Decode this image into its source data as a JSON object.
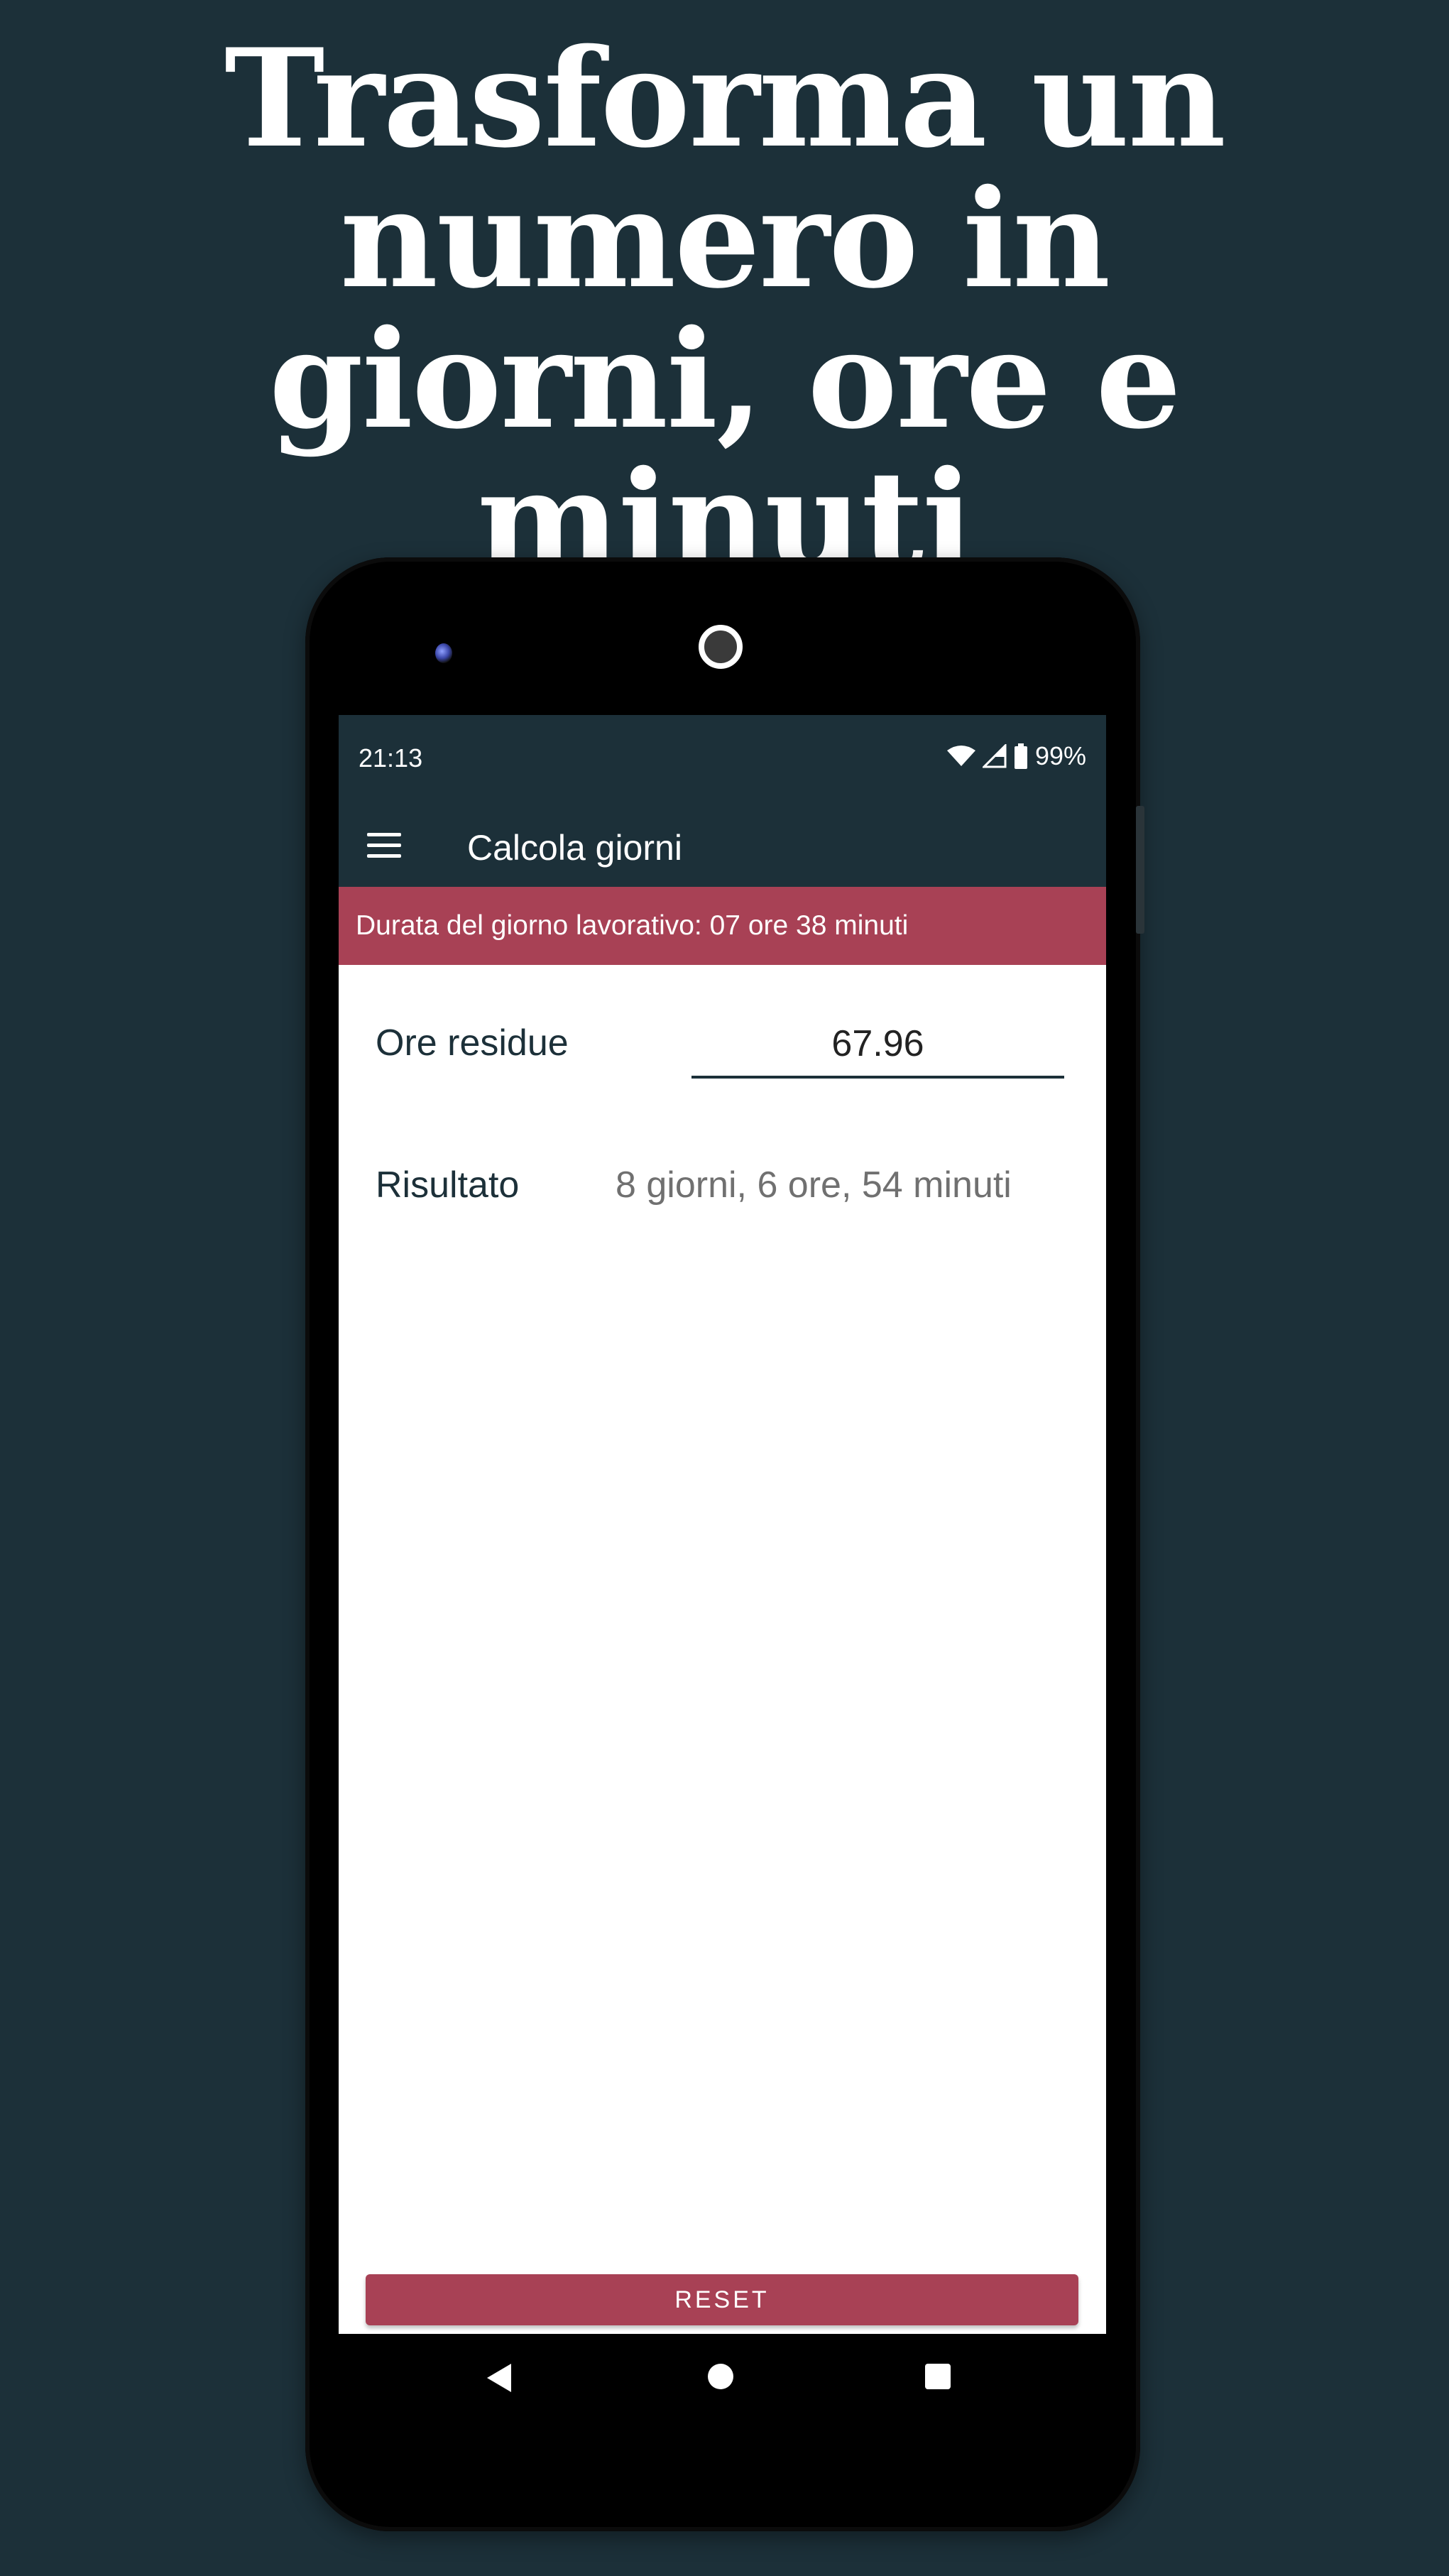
{
  "promo": {
    "headline_lines": [
      "Trasforma un",
      "numero in",
      "giorni, ore e minuti"
    ]
  },
  "status_bar": {
    "time": "21:13",
    "battery": "99%",
    "icons": [
      "wifi-icon",
      "signal-icon",
      "battery-icon"
    ]
  },
  "app_bar": {
    "title": "Calcola giorni",
    "menu_icon": "hamburger-menu-icon"
  },
  "banner": {
    "text": "Durata del giorno lavorativo: 07 ore 38 minuti"
  },
  "form": {
    "hours_label": "Ore residue",
    "hours_value": "67.96",
    "result_label": "Risultato",
    "result_value": "8 giorni, 6 ore, 54 minuti"
  },
  "actions": {
    "reset_label": "RESET"
  },
  "nav_bar": {
    "icons": [
      "back-icon",
      "home-icon",
      "recents-icon"
    ]
  },
  "colors": {
    "background": "#1c3039",
    "accent": "#a84155",
    "primary": "#1c3039"
  }
}
